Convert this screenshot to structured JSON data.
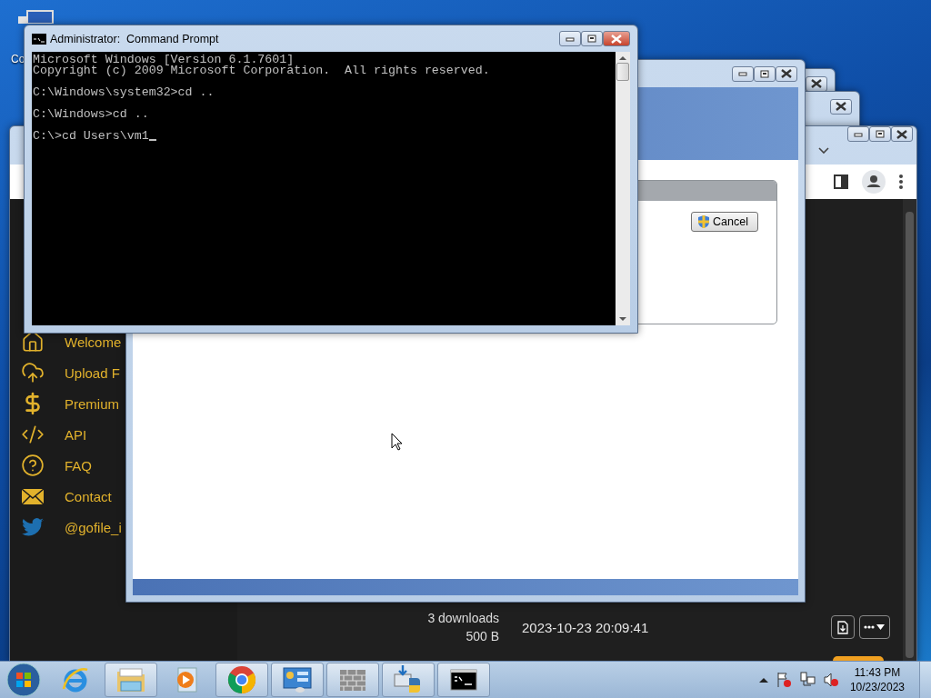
{
  "desktop": {
    "icons": [
      {
        "label": "Co"
      }
    ]
  },
  "back_windows": [
    {
      "kind": "back"
    },
    {
      "kind": "back"
    }
  ],
  "browser": {
    "sidebar": {
      "items": [
        {
          "kind": "home",
          "label": "Welcome"
        },
        {
          "kind": "upload",
          "label": "Upload F"
        },
        {
          "kind": "dollar",
          "label": "Premium"
        },
        {
          "kind": "code",
          "label": "API"
        },
        {
          "kind": "help",
          "label": "FAQ"
        },
        {
          "kind": "mail",
          "label": "Contact"
        },
        {
          "kind": "twitter",
          "label": "@gofile_i"
        }
      ]
    },
    "file_row": {
      "downloads": "3 downloads",
      "size": "500 B",
      "date": "2023-10-23 20:09:41"
    }
  },
  "installer": {
    "cancel_button": "Cancel"
  },
  "console": {
    "title": "Administrator:  Command Prompt",
    "blocks": [
      [
        "Microsoft Windows [Version 6.1.7601]",
        "Copyright (c) 2009 Microsoft Corporation.  All rights reserved."
      ],
      [
        "C:\\Windows\\system32>cd .."
      ],
      [
        "C:\\Windows>cd .."
      ],
      [
        "C:\\>cd Users\\vm1"
      ]
    ]
  },
  "taskbar": {
    "apps": [
      {
        "kind": "ie",
        "running": false
      },
      {
        "kind": "explorer",
        "running": true
      },
      {
        "kind": "media",
        "running": false
      },
      {
        "kind": "chrome",
        "running": true
      },
      {
        "kind": "panel",
        "running": true
      },
      {
        "kind": "firewall",
        "running": true
      },
      {
        "kind": "installer",
        "running": true
      },
      {
        "kind": "console",
        "running": true
      }
    ],
    "clock": {
      "time": "11:43 PM",
      "date": "10/23/2023"
    }
  }
}
